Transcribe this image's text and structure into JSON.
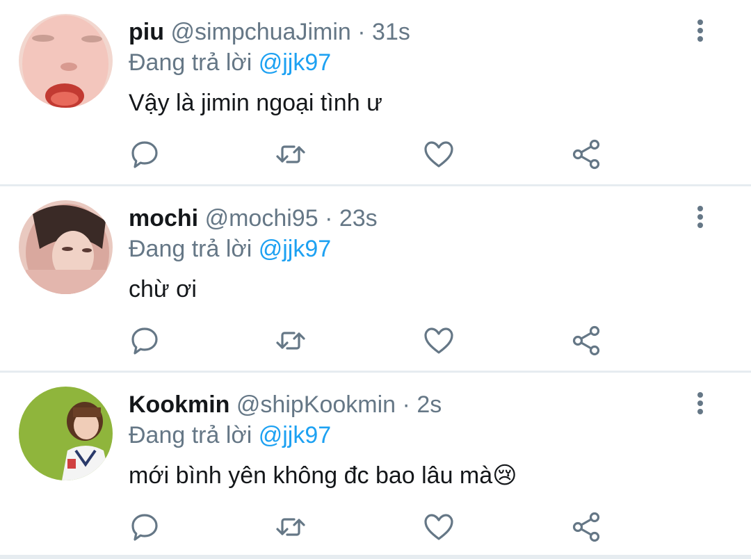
{
  "reply_prefix": "Đang trả lời",
  "tweets": [
    {
      "name": "piu",
      "handle": "@simpchuaJimin",
      "separator": "·",
      "time": "31s",
      "reply_to": "@jjk97",
      "text": "Vậy là jimin ngoại tình ư",
      "emoji": ""
    },
    {
      "name": "mochi",
      "handle": "@mochi95",
      "separator": "·",
      "time": "23s",
      "reply_to": "@jjk97",
      "text": "chừ ơi",
      "emoji": ""
    },
    {
      "name": "Kookmin",
      "handle": "@shipKookmin",
      "separator": "·",
      "time": "2s",
      "reply_to": "@jjk97",
      "text": "mới bình yên không đc bao lâu mà",
      "emoji": "😢"
    }
  ],
  "icons": {
    "reply": "reply-icon",
    "retweet": "retweet-icon",
    "like": "heart-icon",
    "share": "share-icon",
    "more": "more-vertical-icon"
  },
  "colors": {
    "text": "#14171a",
    "muted": "#657786",
    "mention": "#1da1f2",
    "divider": "#e6ecf0"
  }
}
